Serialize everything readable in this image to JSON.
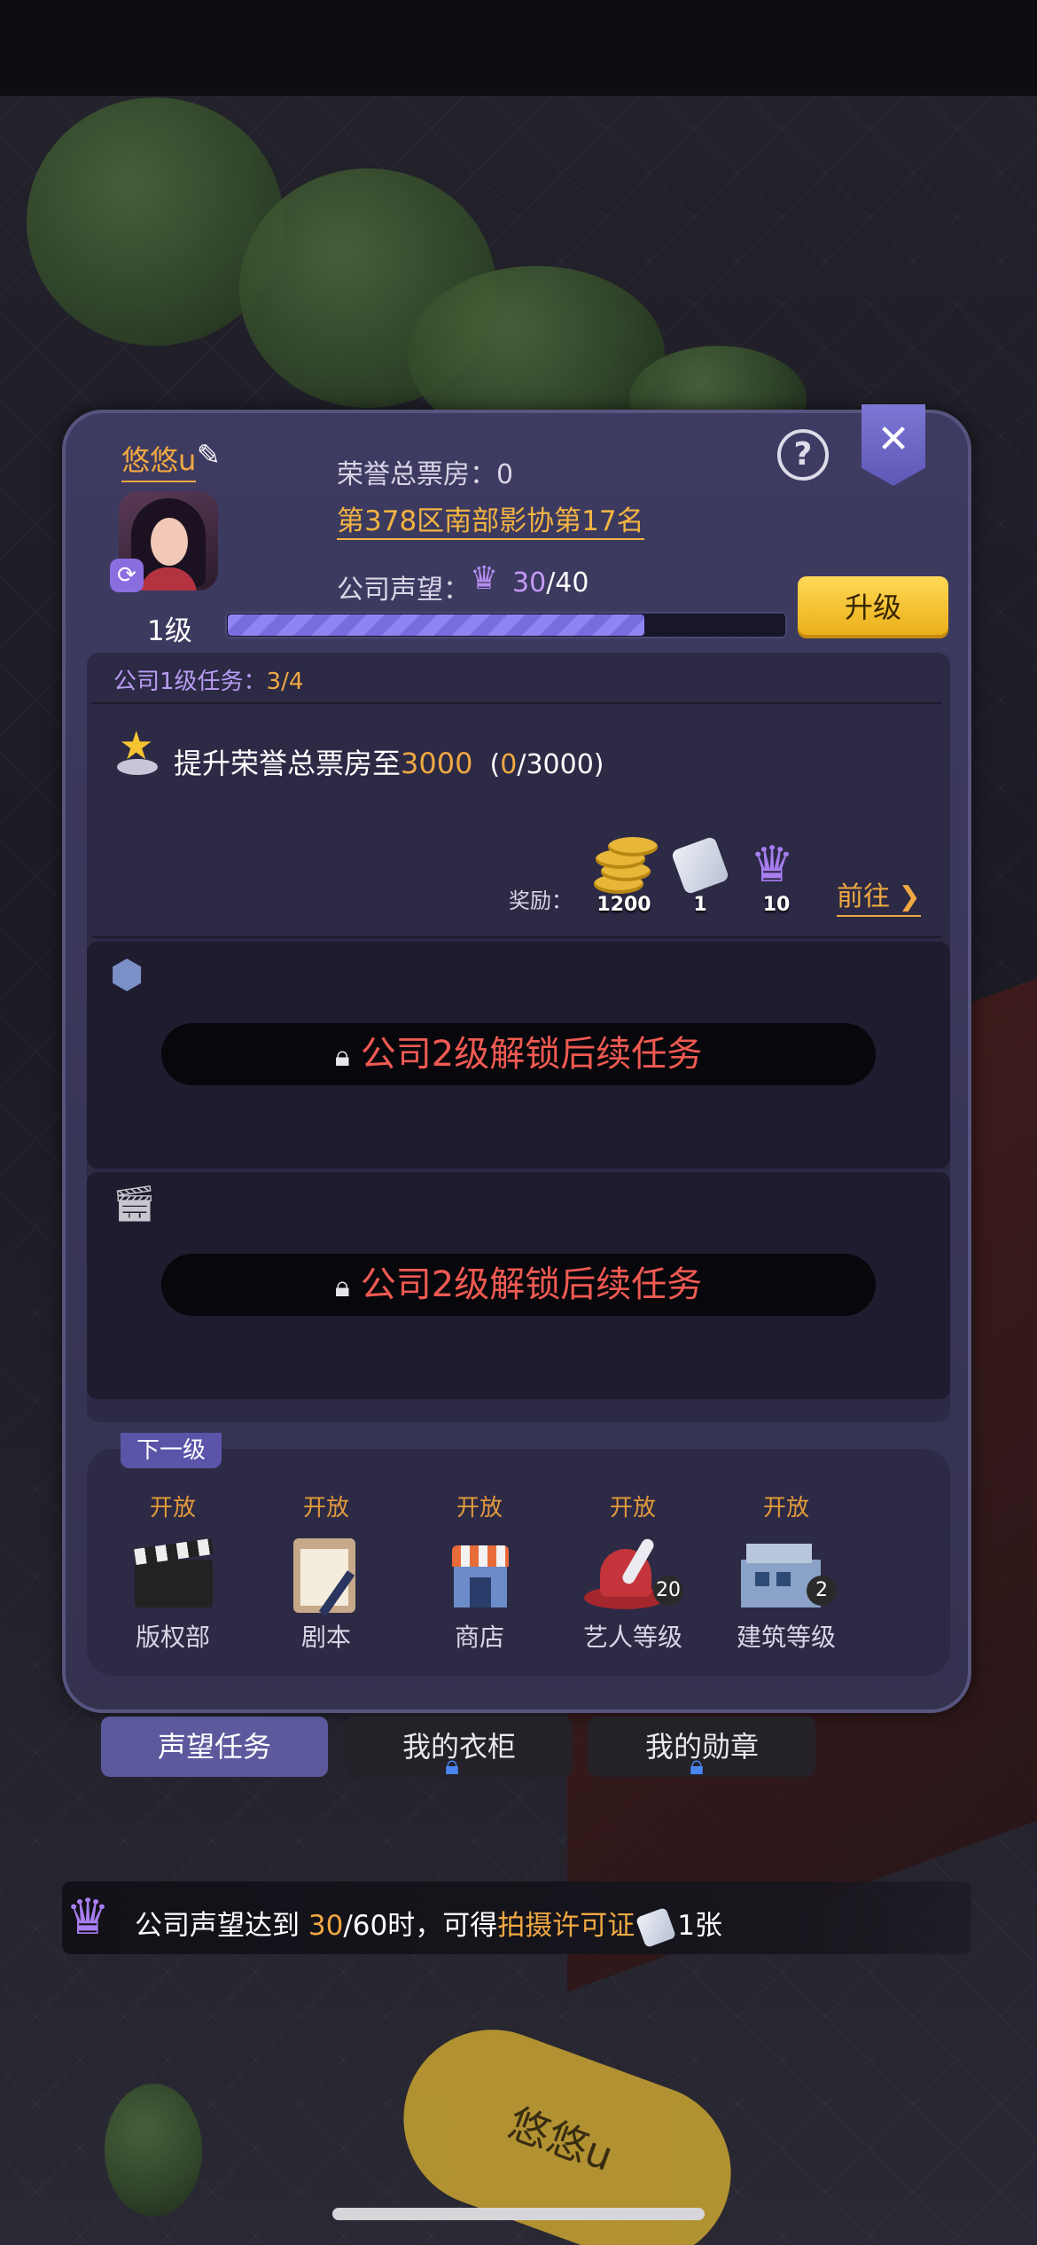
{
  "player": {
    "name": "悠悠u",
    "level": "1级"
  },
  "stats": {
    "honor_label": "荣誉总票房：0",
    "rank": "第378区南部影协第17名",
    "reputation_label": "公司声望：",
    "reputation_current": "30",
    "reputation_max": "/40",
    "progress_fraction": 0.75
  },
  "buttons": {
    "upgrade": "升级",
    "goto": "前往",
    "close": "✕",
    "help": "?"
  },
  "tasks": {
    "header": "公司1级任务：",
    "header_count": "3/4",
    "task_prefix": "提升荣誉总票房至",
    "task_target": "3000",
    "task_progress_open": "(",
    "task_progress_current": "0",
    "task_progress_rest": "/3000)",
    "reward_label": "奖励：",
    "rewards": [
      {
        "icon": "gold-coins-icon",
        "amount": "1200"
      },
      {
        "icon": "scroll-icon",
        "amount": "1"
      },
      {
        "icon": "crown-icon",
        "amount": "10"
      }
    ],
    "locked_text_1": "公司2级解锁后续任务",
    "locked_text_2": "公司2级解锁后续任务"
  },
  "next_level": {
    "tag": "下一级",
    "items": [
      {
        "status": "开放",
        "name": "版权部",
        "icon": "clapperboard-icon",
        "badge": ""
      },
      {
        "status": "开放",
        "name": "剧本",
        "icon": "script-clipboard-icon",
        "badge": ""
      },
      {
        "status": "开放",
        "name": "商店",
        "icon": "shop-icon",
        "badge": ""
      },
      {
        "status": "开放",
        "name": "艺人等级",
        "icon": "artist-hat-icon",
        "badge": "20"
      },
      {
        "status": "开放",
        "name": "建筑等级",
        "icon": "building-icon",
        "badge": "2"
      }
    ]
  },
  "tabs": [
    {
      "label": "声望任务",
      "active": true
    },
    {
      "label": "我的衣柜",
      "active": false
    },
    {
      "label": "我的勋章",
      "active": false
    }
  ],
  "banner": {
    "part1": "公司声望达到 ",
    "value": "30",
    "part2": "/60时，可得",
    "item": "拍摄许可证",
    "count": "1张"
  },
  "background": {
    "sign_text": "悠悠u"
  },
  "colors": {
    "accent_orange": "#f0a842",
    "accent_purple": "#b48cf0",
    "lock_red": "#f05a52",
    "upgrade_yellow": "#ffd955"
  }
}
